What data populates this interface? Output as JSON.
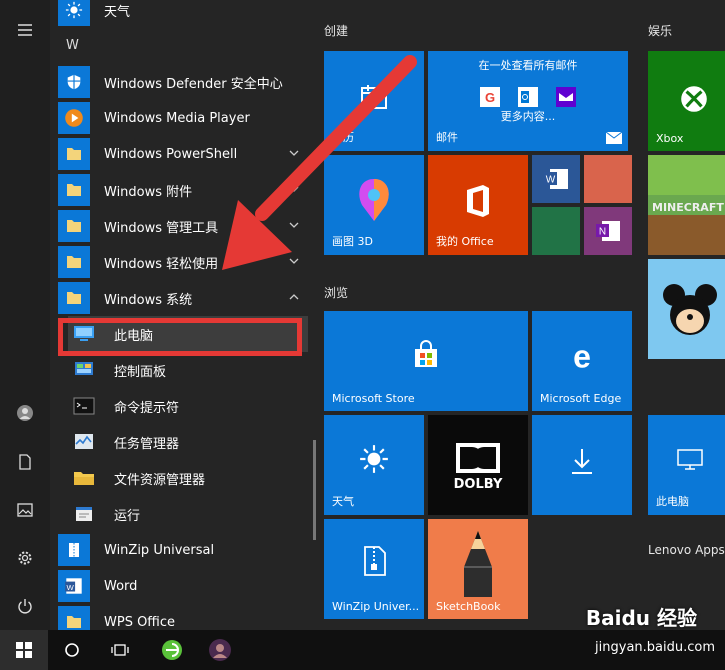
{
  "applist": {
    "top_item": "天气",
    "letter": "W",
    "items": [
      {
        "label": "Windows Defender 安全中心",
        "icon": "shield-icon"
      },
      {
        "label": "Windows Media Player",
        "icon": "media-player-icon"
      },
      {
        "label": "Windows PowerShell",
        "icon": "folder-icon",
        "expandable": true
      },
      {
        "label": "Windows 附件",
        "icon": "folder-icon",
        "expandable": true
      },
      {
        "label": "Windows 管理工具",
        "icon": "folder-icon",
        "expandable": true
      },
      {
        "label": "Windows 轻松使用",
        "icon": "folder-icon",
        "expandable": true
      },
      {
        "label": "Windows 系统",
        "icon": "folder-icon",
        "expanded": true
      }
    ],
    "system_items": [
      {
        "label": "此电脑",
        "icon": "computer-icon",
        "selected": true
      },
      {
        "label": "控制面板",
        "icon": "control-panel-icon"
      },
      {
        "label": "命令提示符",
        "icon": "cmd-icon"
      },
      {
        "label": "任务管理器",
        "icon": "task-manager-icon"
      },
      {
        "label": "文件资源管理器",
        "icon": "file-explorer-icon"
      },
      {
        "label": "运行",
        "icon": "run-icon"
      }
    ],
    "after_items": [
      {
        "label": "WinZip Universal",
        "icon": "winzip-icon"
      },
      {
        "label": "Word",
        "icon": "word-icon"
      },
      {
        "label": "WPS Office",
        "icon": "folder-icon"
      }
    ]
  },
  "groups": {
    "create": "创建",
    "browse": "浏览",
    "entertain": "娱乐",
    "lenovo": "Lenovo Apps"
  },
  "tiles": {
    "calendar": "日历",
    "mail_top": "在一处查看所有邮件",
    "mail_more": "更多内容...",
    "mail": "邮件",
    "xbox": "Xbox",
    "paint3d": "画图 3D",
    "myoffice": "我的 Office",
    "minecraft": "MINECRAFT",
    "store": "Microsoft Store",
    "edge": "Microsoft Edge",
    "weather": "天气",
    "dolby": "DOLBY",
    "thispc": "此电脑",
    "winzip": "WinZip Univer...",
    "sketchbook": "SketchBook"
  },
  "watermark": {
    "brand": "Baidu 经验",
    "url": "jingyan.baidu.com"
  },
  "colors": {
    "tile_blue": "#0b78d7",
    "office_orange": "#d83b01",
    "highlight_red": "#e53935"
  }
}
